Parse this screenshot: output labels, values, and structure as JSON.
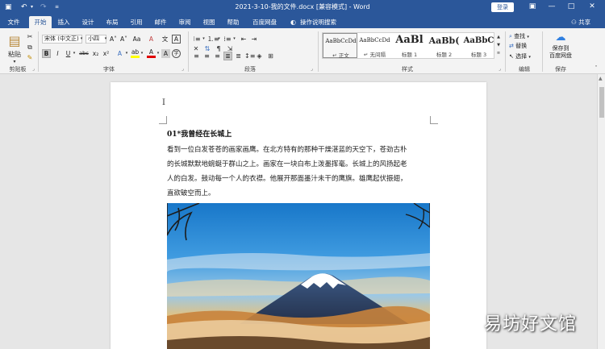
{
  "titlebar": {
    "title": "2021-3-10-我的文件.docx [兼容模式]  -  Word",
    "login_label": "登录",
    "minimize": "—",
    "restore": "□",
    "close": "✕",
    "ribbon_display": "▣"
  },
  "tabs": [
    "文件",
    "开始",
    "插入",
    "设计",
    "布局",
    "引用",
    "邮件",
    "审阅",
    "视图",
    "帮助",
    "百度网盘"
  ],
  "active_tab": "开始",
  "tell_me": "操作说明搜索",
  "share_label": "共享",
  "clipboard": {
    "paste_label": "粘贴",
    "group_label": "剪贴板"
  },
  "font": {
    "font_name": "宋体 (中文正)",
    "font_size": "小四",
    "group_label": "字体",
    "bold": "B",
    "italic": "I",
    "underline": "U",
    "strike": "abc",
    "subscript": "x₂",
    "superscript": "x²",
    "grow": "A˄",
    "shrink": "A˅",
    "case": "Aa",
    "clear": "A",
    "phonetic": "文",
    "border": "A",
    "effects": "A",
    "highlight": "ab",
    "color": "A",
    "shade": "A",
    "enclose": "字"
  },
  "paragraph": {
    "group_label": "段落"
  },
  "styles": {
    "group_label": "样式",
    "items": [
      {
        "preview": "AaBbCcDd",
        "name": "↵ 正文"
      },
      {
        "preview": "AaBbCcDd",
        "name": "↵ 无间隔"
      },
      {
        "preview": "AaBl",
        "name": "标题 1"
      },
      {
        "preview": "AaBb(",
        "name": "标题 2"
      },
      {
        "preview": "AaBbC",
        "name": "标题 3"
      }
    ]
  },
  "editing": {
    "group_label": "编辑",
    "find": "查找",
    "replace": "替换",
    "select": "选择"
  },
  "save": {
    "group_label": "保存",
    "button_line1": "保存到",
    "button_line2": "百度网盘"
  },
  "document": {
    "heading": "01*我曾经在长城上",
    "lines": [
      "看到一位白发苍苍的画家画鹰。在北方特有的那种干燥湛蓝的天空下，苍劲古朴",
      "的长城默默地蜿蜒于群山之上。画家在一块白布上泼墨挥毫。长城上的风扬起老",
      "人的白发。鼓动每一个人的衣襟。他展开那面墨汁未干的鹰旗。雄鹰起伏振翅，",
      "直欲破空而上。"
    ]
  },
  "watermark": "易坊好文馆",
  "colors": {
    "brand": "#2b579a",
    "font_color": "#e00000",
    "highlight": "#ffff00"
  }
}
